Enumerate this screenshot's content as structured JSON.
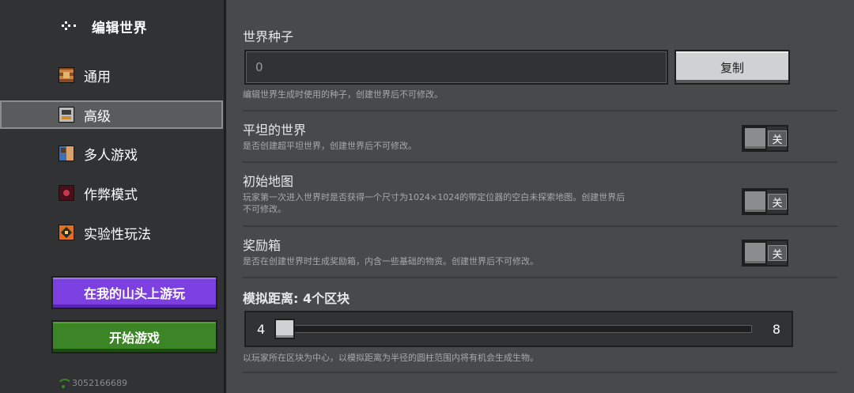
{
  "sidebar": {
    "title": "编辑世界",
    "items": [
      {
        "label": "通用",
        "icon": "general-icon"
      },
      {
        "label": "高级",
        "icon": "advanced-icon"
      },
      {
        "label": "多人游戏",
        "icon": "multiplayer-icon"
      },
      {
        "label": "作弊模式",
        "icon": "cheats-icon"
      },
      {
        "label": "实验性玩法",
        "icon": "experiments-icon"
      }
    ],
    "active_item": "高级",
    "realm_button": "在我的山头上游玩",
    "play_button": "开始游戏",
    "connection_id": "3052166689"
  },
  "seed": {
    "title": "世界种子",
    "value": "0",
    "copy_label": "复制",
    "desc": "编辑世界生成时使用的种子，创建世界后不可修改。"
  },
  "flat_world": {
    "title": "平坦的世界",
    "desc": "是否创建超平坦世界，创建世界后不可修改。",
    "toggle_label": "关",
    "enabled": false
  },
  "starting_map": {
    "title": "初始地图",
    "desc_line1": "玩家第一次进入世界时是否获得一个尺寸为1024×1024的带定位器的空白未探索地图。创建世界后",
    "desc_line2": "不可修改。",
    "toggle_label": "关",
    "enabled": false
  },
  "bonus_chest": {
    "title": "奖励箱",
    "desc": "是否在创建世界时生成奖励箱，内含一些基础的物资。创建世界后不可修改。",
    "toggle_label": "关",
    "enabled": false
  },
  "simulation": {
    "title": "模拟距离: 4个区块",
    "min": "4",
    "max": "8",
    "value": 4,
    "desc": "以玩家所在区块为中心，以模拟距离为半径的圆柱范围内将有机会生成生物。"
  },
  "colors": {
    "realm_purple": "#7c3fe0",
    "play_green": "#3c8527",
    "panel": "#48494a",
    "sidebar": "#313233"
  }
}
